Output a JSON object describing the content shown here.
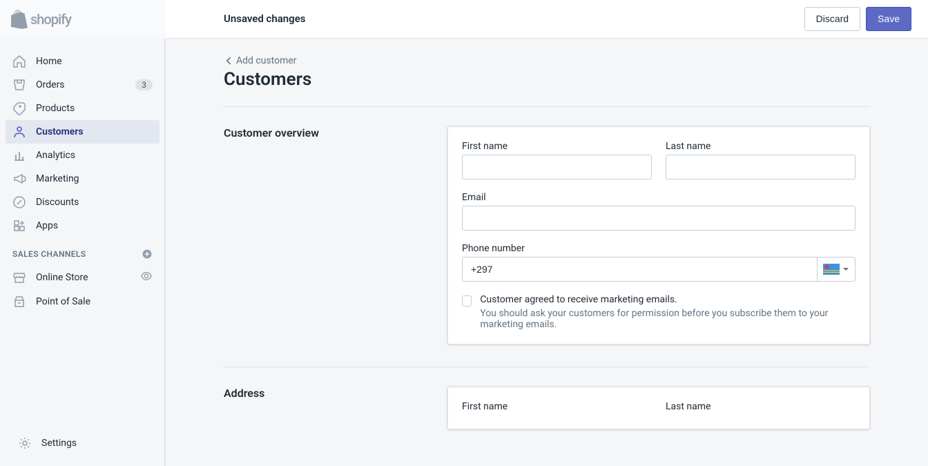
{
  "header": {
    "brand": "shopify",
    "unsaved_label": "Unsaved changes",
    "discard_label": "Discard",
    "save_label": "Save"
  },
  "sidebar": {
    "items": [
      {
        "label": "Home"
      },
      {
        "label": "Orders",
        "badge": "3"
      },
      {
        "label": "Products"
      },
      {
        "label": "Customers"
      },
      {
        "label": "Analytics"
      },
      {
        "label": "Marketing"
      },
      {
        "label": "Discounts"
      },
      {
        "label": "Apps"
      }
    ],
    "channels_heading": "SALES CHANNELS",
    "channels": [
      {
        "label": "Online Store"
      },
      {
        "label": "Point of Sale"
      }
    ],
    "settings_label": "Settings"
  },
  "page": {
    "breadcrumb": "Add customer",
    "title": "Customers"
  },
  "overview": {
    "heading": "Customer overview",
    "first_name_label": "First name",
    "first_name_value": "",
    "last_name_label": "Last name",
    "last_name_value": "",
    "email_label": "Email",
    "email_value": "",
    "phone_label": "Phone number",
    "phone_value": "+297",
    "marketing_checkbox_label": "Customer agreed to receive marketing emails.",
    "marketing_help": "You should ask your customers for permission before you subscribe them to your marketing emails."
  },
  "address": {
    "heading": "Address",
    "first_name_label": "First name",
    "last_name_label": "Last name"
  }
}
